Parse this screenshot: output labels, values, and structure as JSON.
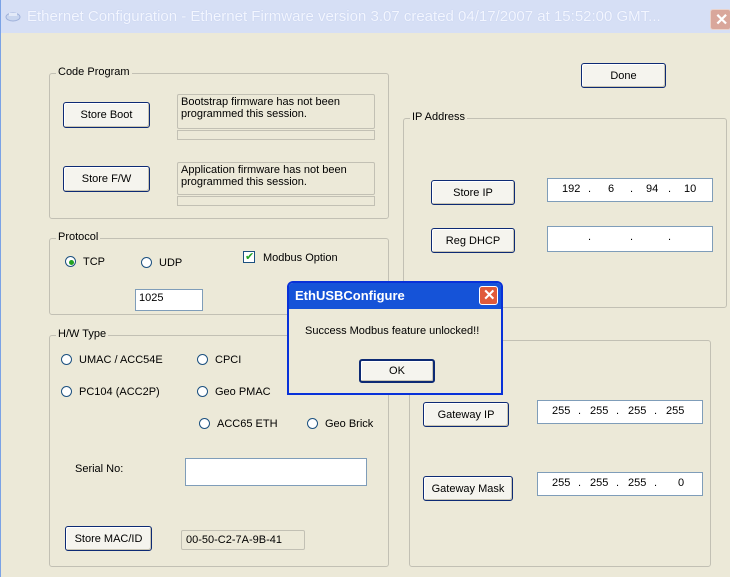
{
  "window": {
    "title": "Ethernet Configuration - Ethernet Firmware version 3.07 created 04/17/2007 at 15:52:00 GMT...",
    "close_icon": "close-icon"
  },
  "done_label": "Done",
  "code_program": {
    "legend": "Code Program",
    "store_boot_label": "Store Boot",
    "boot_message": "Bootstrap firmware has not been programmed this session.",
    "store_fw_label": "Store F/W",
    "fw_message": "Application firmware has not been programmed this session."
  },
  "ip_address": {
    "legend": "IP Address",
    "store_ip_label": "Store IP",
    "ip": [
      "192",
      "6",
      "94",
      "10"
    ],
    "reg_dhcp_label": "Reg DHCP",
    "dhcp_dots": [
      ".",
      ".",
      "."
    ]
  },
  "protocol": {
    "legend": "Protocol",
    "tcp_label": "TCP",
    "udp_label": "UDP",
    "selected": "TCP",
    "modbus_label": "Modbus Option",
    "modbus_checked": true,
    "port": "1025"
  },
  "hw_type": {
    "legend": "H/W Type",
    "options": [
      "UMAC / ACC54E",
      "CPCI",
      "PC104 (ACC2P)",
      "Geo PMAC",
      "ACC65 ETH",
      "Geo Brick"
    ],
    "serial_label": "Serial No:",
    "serial_value": "",
    "store_mac_label": "Store MAC/ID",
    "mac_value": "00-50-C2-7A-9B-41"
  },
  "gateway": {
    "gateway_ip_label": "Gateway IP",
    "gateway_ip": [
      "255",
      "255",
      "255",
      "255"
    ],
    "gateway_mask_label": "Gateway Mask",
    "gateway_mask": [
      "255",
      "255",
      "255",
      "0"
    ]
  },
  "dialog": {
    "title": "EthUSBConfigure",
    "message": "Success Modbus feature unlocked!!",
    "ok_label": "OK"
  }
}
